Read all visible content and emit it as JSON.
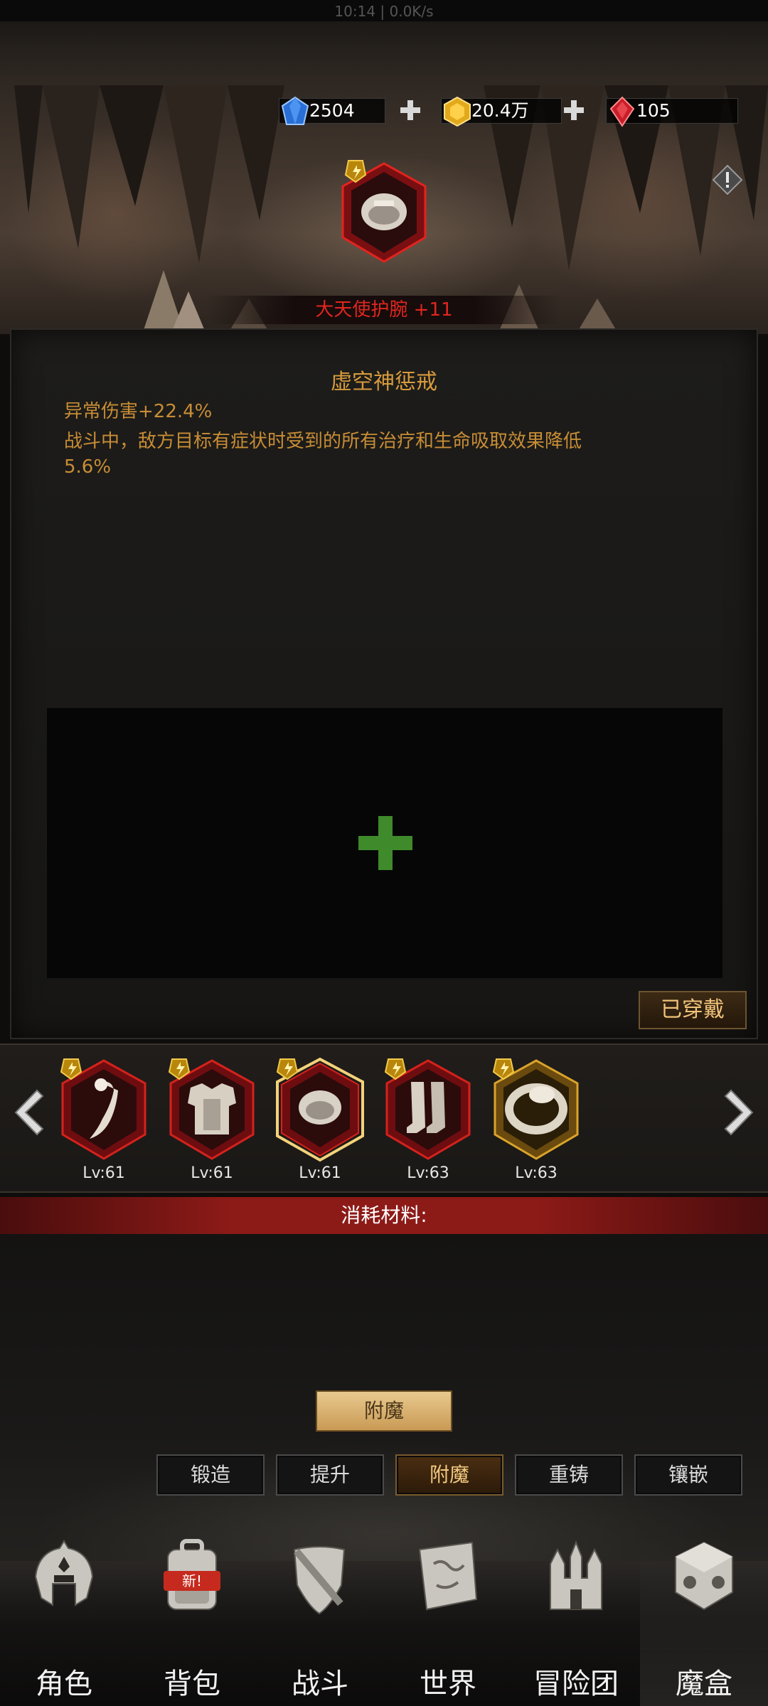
{
  "status_bar": {
    "text": "10:14 | 0.0K/s"
  },
  "currency": {
    "diamond": {
      "icon": "blue-diamond-icon",
      "value": "2504"
    },
    "gold": {
      "icon": "gold-gem-icon",
      "value": "20.4万"
    },
    "ruby": {
      "icon": "red-gem-icon",
      "value": "105"
    }
  },
  "selected_item": {
    "name": "大天使护腕 +11",
    "icon": "bracer-icon"
  },
  "enchant": {
    "title": "虚空神惩戒",
    "lines": [
      "异常伤害+22.4%",
      "战斗中，敌方目标有症状时受到的所有治疗和生命吸取效果降低",
      "5.6%"
    ]
  },
  "worn_button": "已穿戴",
  "equipment": [
    {
      "icon": "scarf-icon",
      "level": "Lv:61",
      "frame": "red"
    },
    {
      "icon": "armor-icon",
      "level": "Lv:61",
      "frame": "red"
    },
    {
      "icon": "bracer-icon",
      "level": "Lv:61",
      "frame": "red-selected"
    },
    {
      "icon": "boots-icon",
      "level": "Lv:63",
      "frame": "red"
    },
    {
      "icon": "ring-icon",
      "level": "Lv:63",
      "frame": "gold"
    }
  ],
  "materials_label": "消耗材料:",
  "action_button": "附魔",
  "tabs": [
    {
      "label": "锻造",
      "active": false
    },
    {
      "label": "提升",
      "active": false
    },
    {
      "label": "附魔",
      "active": true
    },
    {
      "label": "重铸",
      "active": false
    },
    {
      "label": "镶嵌",
      "active": false
    }
  ],
  "nav": [
    {
      "label": "角色",
      "icon": "helmet-icon",
      "active": false
    },
    {
      "label": "背包",
      "icon": "backpack-icon",
      "active": false,
      "badge": "新!"
    },
    {
      "label": "战斗",
      "icon": "sword-shield-icon",
      "active": false
    },
    {
      "label": "世界",
      "icon": "map-scroll-icon",
      "active": false
    },
    {
      "label": "冒险团",
      "icon": "castle-icon",
      "active": false
    },
    {
      "label": "魔盒",
      "icon": "magic-cube-icon",
      "active": true
    }
  ],
  "colors": {
    "enchant_text": "#c88d35",
    "item_name": "#e0261e",
    "materials_bar": "#8c1a17",
    "plus_green": "#3f8a2b"
  }
}
